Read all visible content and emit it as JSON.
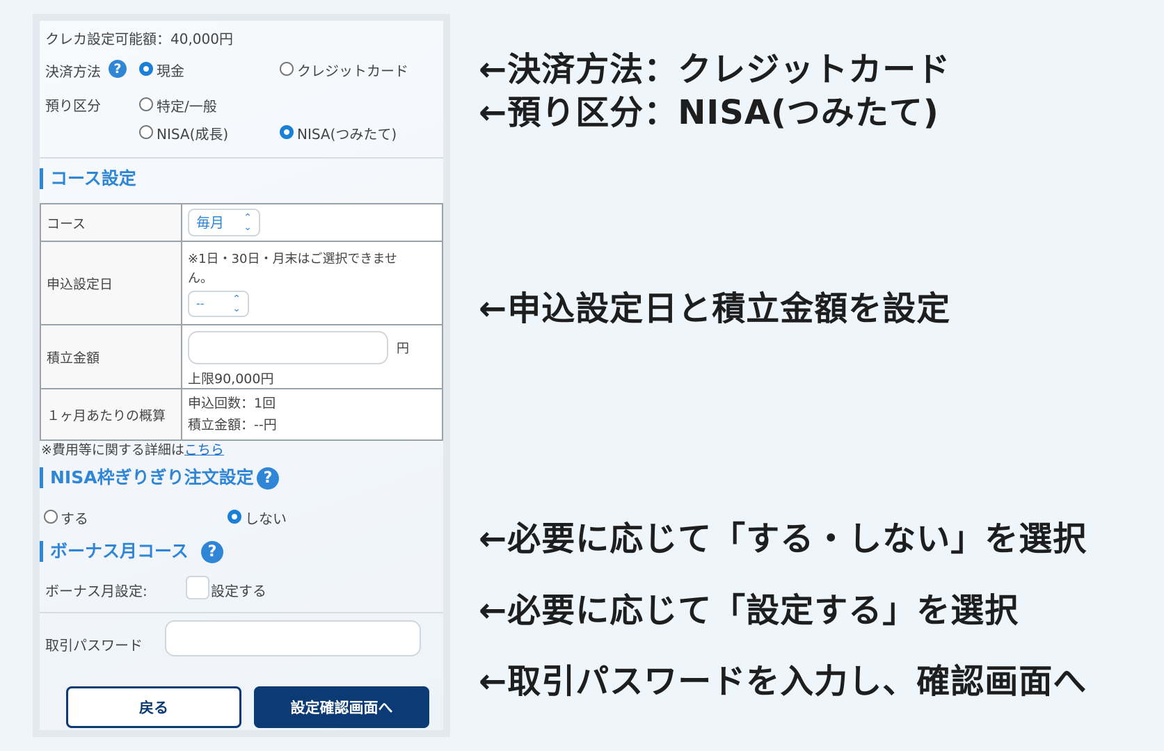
{
  "form": {
    "credit_limit": "クレカ設定可能額：40,000円",
    "payment": {
      "label": "決済方法",
      "help": "?",
      "options": [
        {
          "label": "現金",
          "selected": true
        },
        {
          "label": "クレジットカード",
          "selected": false
        }
      ]
    },
    "deposit": {
      "label": "預り区分",
      "options": [
        {
          "label": "特定/一般",
          "selected": false
        },
        {
          "label": "NISA(成長)",
          "selected": false
        },
        {
          "label": "NISA(つみたて)",
          "selected": true
        }
      ]
    },
    "course_section": {
      "title": "コース設定",
      "course_label": "コース",
      "course_value": "毎月",
      "date_label": "申込設定日",
      "date_note_line1": "※1日・30日・月末はご選択できませ",
      "date_note_line2": "ん。",
      "date_value": "--",
      "amount_label": "積立金額",
      "amount_value": "",
      "amount_unit": "円",
      "amount_limit": "上限90,000円",
      "summary_label": "１ヶ月あたりの概算",
      "summary_count": "申込回数：1回",
      "summary_amount": "積立金額：--円"
    },
    "fee_note_prefix": "※費用等に関する詳細は",
    "fee_note_link": "こちら",
    "nisa_limit": {
      "title": "NISA枠ぎりぎり注文設定",
      "help": "?",
      "options": [
        {
          "label": "する",
          "selected": false
        },
        {
          "label": "しない",
          "selected": true
        }
      ]
    },
    "bonus": {
      "title": "ボーナス月コース",
      "help": "?",
      "label": "ボーナス月設定:",
      "checkbox_label": "設定する",
      "checked": false
    },
    "password": {
      "label": "取引パスワード",
      "value": ""
    },
    "buttons": {
      "back": "戻る",
      "next": "設定確認画面へ"
    }
  },
  "annotations": {
    "a1": "←決済方法：クレジットカード",
    "a2": "←預り区分：NISA(つみたて)",
    "a3": "←申込設定日と積立金額を設定",
    "a4": "←必要に応じて「する・しない」を選択",
    "a5": "←必要に応じて「設定する」を選択",
    "a6": "←取引パスワードを入力し、確認画面へ"
  },
  "colors": {
    "accent": "#2f86d6",
    "button_primary": "#0c3a75",
    "background": "#eef6fc"
  }
}
